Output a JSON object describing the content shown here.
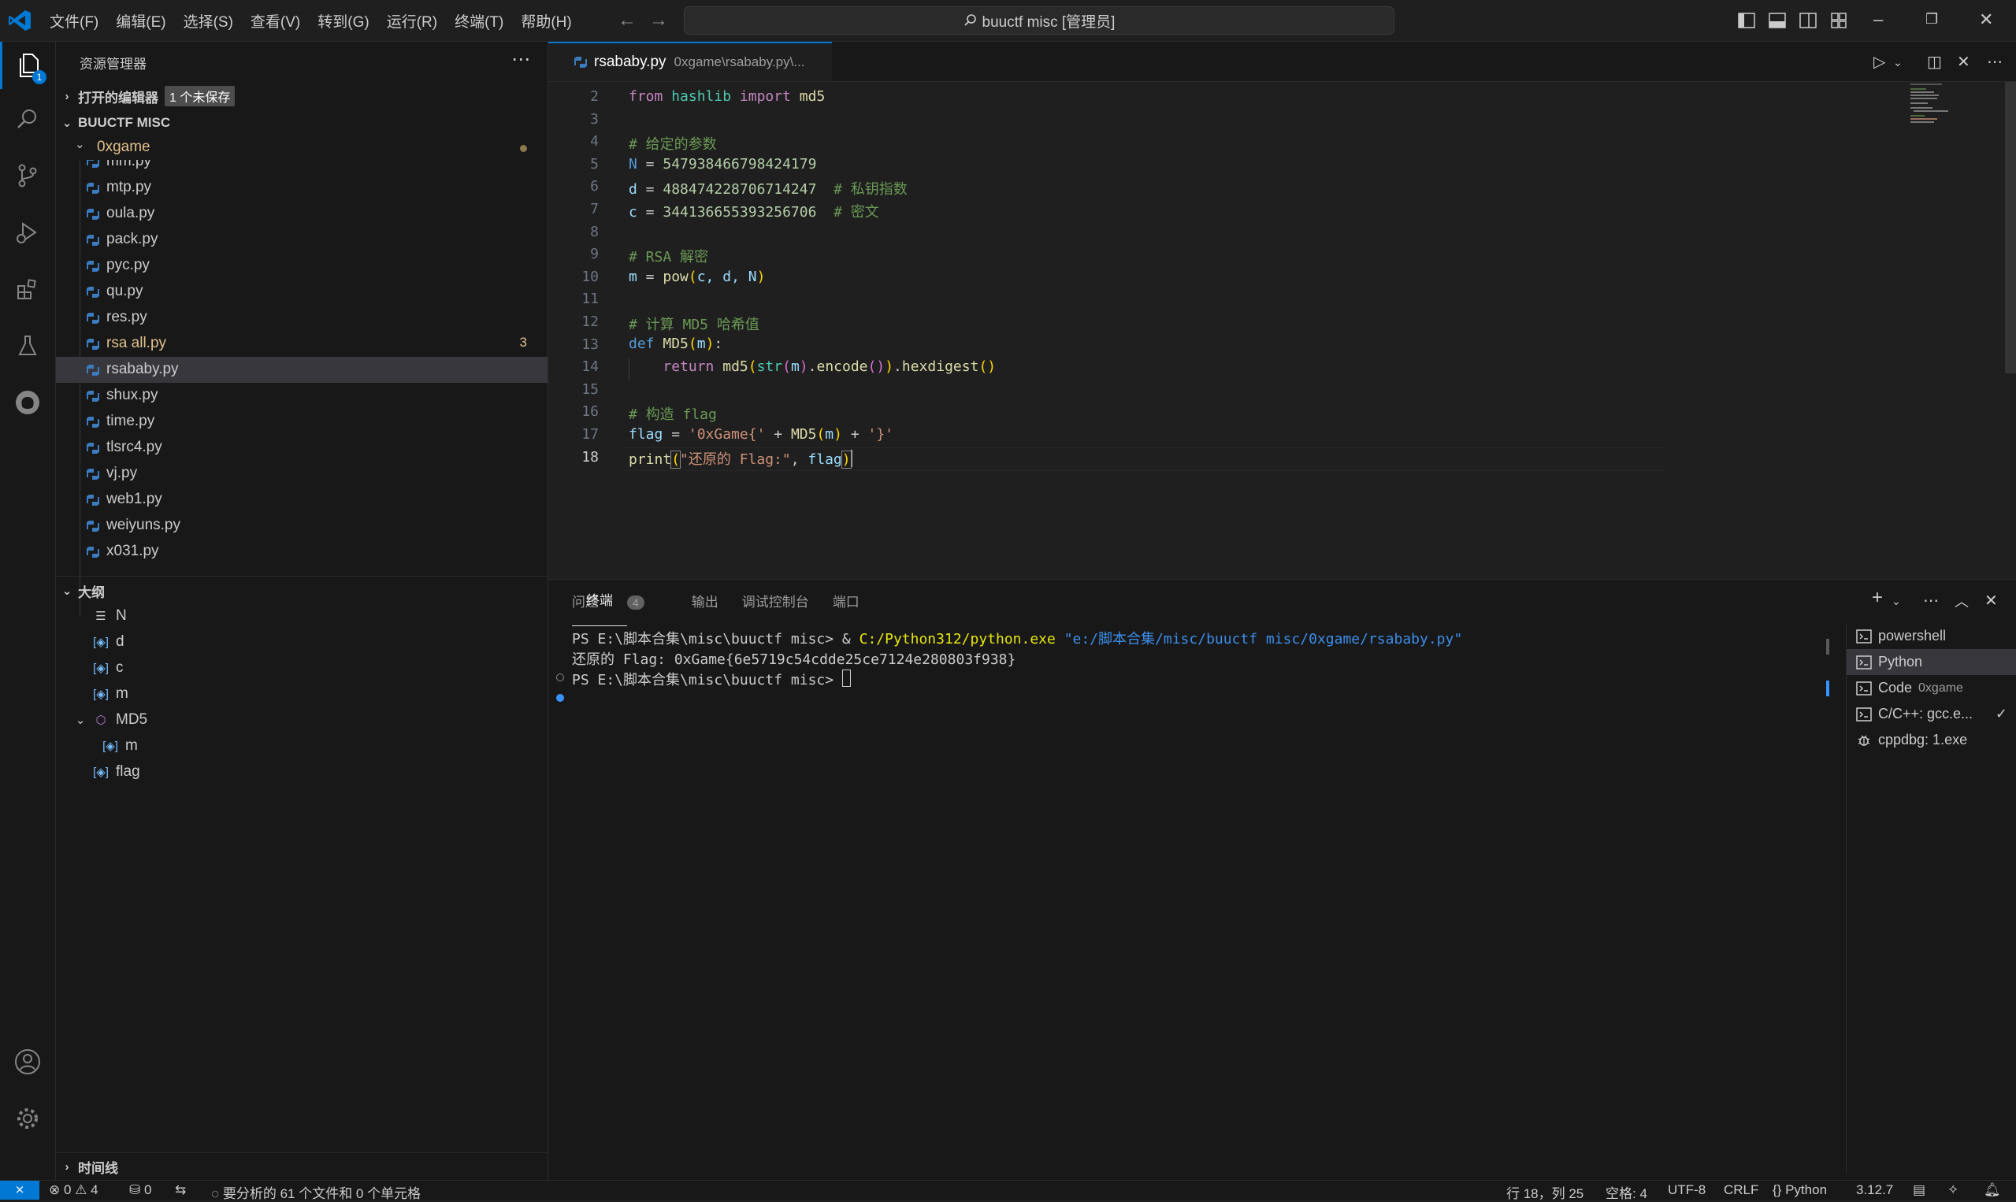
{
  "menu": [
    "文件(F)",
    "编辑(E)",
    "选择(S)",
    "查看(V)",
    "转到(G)",
    "运行(R)",
    "终端(T)",
    "帮助(H)"
  ],
  "command_center": "buuctf misc [管理员]",
  "activity_badge": "1",
  "sidebar": {
    "title": "资源管理器",
    "open_editors": "打开的编辑器",
    "unsaved": "1 个未保存",
    "workspace": "BUUCTF MISC",
    "folder": "0xgame",
    "files": [
      {
        "name": "mm.py"
      },
      {
        "name": "mtp.py"
      },
      {
        "name": "oula.py"
      },
      {
        "name": "pack.py"
      },
      {
        "name": "pyc.py"
      },
      {
        "name": "qu.py"
      },
      {
        "name": "res.py"
      },
      {
        "name": "rsa all.py",
        "problems": "3"
      },
      {
        "name": "rsababy.py"
      },
      {
        "name": "shux.py"
      },
      {
        "name": "time.py"
      },
      {
        "name": "tlsrc4.py"
      },
      {
        "name": "vj.py"
      },
      {
        "name": "web1.py"
      },
      {
        "name": "weiyuns.py"
      },
      {
        "name": "x031.py"
      }
    ],
    "outline_title": "大纲",
    "outline": [
      "N",
      "d",
      "c",
      "m",
      "MD5",
      "m",
      "flag"
    ],
    "timeline": "时间线"
  },
  "editor": {
    "tab_name": "rsababy.py",
    "tab_path": "0xgame\\rsababy.py\\...",
    "line_numbers": [
      "2",
      "3",
      "4",
      "5",
      "6",
      "7",
      "8",
      "9",
      "10",
      "11",
      "12",
      "13",
      "14",
      "15",
      "16",
      "17",
      "18"
    ],
    "code": {
      "l2_from": "from",
      "l2_mod": "hashlib",
      "l2_import": "import",
      "l2_name": "md5",
      "l4": "# 给定的参数",
      "l5_var": "N",
      "l5_val": "547938466798424179",
      "l6_var": "d",
      "l6_val": "488474228706714247",
      "l6_cm": "# 私钥指数",
      "l7_var": "c",
      "l7_val": "344136655393256706",
      "l7_cm": "# 密文",
      "l9": "# RSA 解密",
      "l10_var": "m",
      "l10_fn": "pow",
      "l10_args": "c, d, N",
      "l12": "# 计算 MD5 哈希值",
      "l13_def": "def",
      "l13_fn": "MD5",
      "l13_arg": "m",
      "l14_ret": "return",
      "l14_md5": "md5",
      "l14_str": "str",
      "l14_m": "m",
      "l14_enc": "encode",
      "l14_hex": "hexdigest",
      "l16": "# 构造 flag",
      "l17_var": "flag",
      "l17_s1": "'0xGame{'",
      "l17_fn": "MD5",
      "l17_m": "m",
      "l17_s2": "'}'",
      "l18_fn": "print",
      "l18_s": "\"还原的 Flag:\"",
      "l18_var": "flag"
    }
  },
  "panel": {
    "tabs": [
      "问题",
      "输出",
      "调试控制台",
      "终端",
      "端口"
    ],
    "problems_count": "4",
    "terminal": {
      "line1_prompt": "PS E:\\脚本合集\\misc\\buuctf misc> & ",
      "line1_exe": "C:/Python312/python.exe",
      "line1_arg": "\"e:/脚本合集/misc/buuctf misc/0xgame/rsababy.py\"",
      "line2": "还原的 Flag: 0xGame{6e5719c54cdde25ce7124e280803f938}",
      "line3": "PS E:\\脚本合集\\misc\\buuctf misc> "
    },
    "terminals": [
      {
        "name": "powershell",
        "sub": ""
      },
      {
        "name": "Python",
        "sub": ""
      },
      {
        "name": "Code",
        "sub": "0xgame"
      },
      {
        "name": "C/C++: gcc.e...",
        "sub": ""
      },
      {
        "name": "cppdbg: 1.exe",
        "sub": ""
      }
    ]
  },
  "status": {
    "errors": "0",
    "warnings": "4",
    "ports": "0",
    "analysis": "要分析的 61 个文件和 0 个单元格",
    "position": "行 18，列 25",
    "spaces": "空格: 4",
    "encoding": "UTF-8",
    "eol": "CRLF",
    "language": "Python",
    "version": "3.12.7"
  },
  "colors": {
    "accent": "#0078d4",
    "modified": "#e2c08d"
  }
}
